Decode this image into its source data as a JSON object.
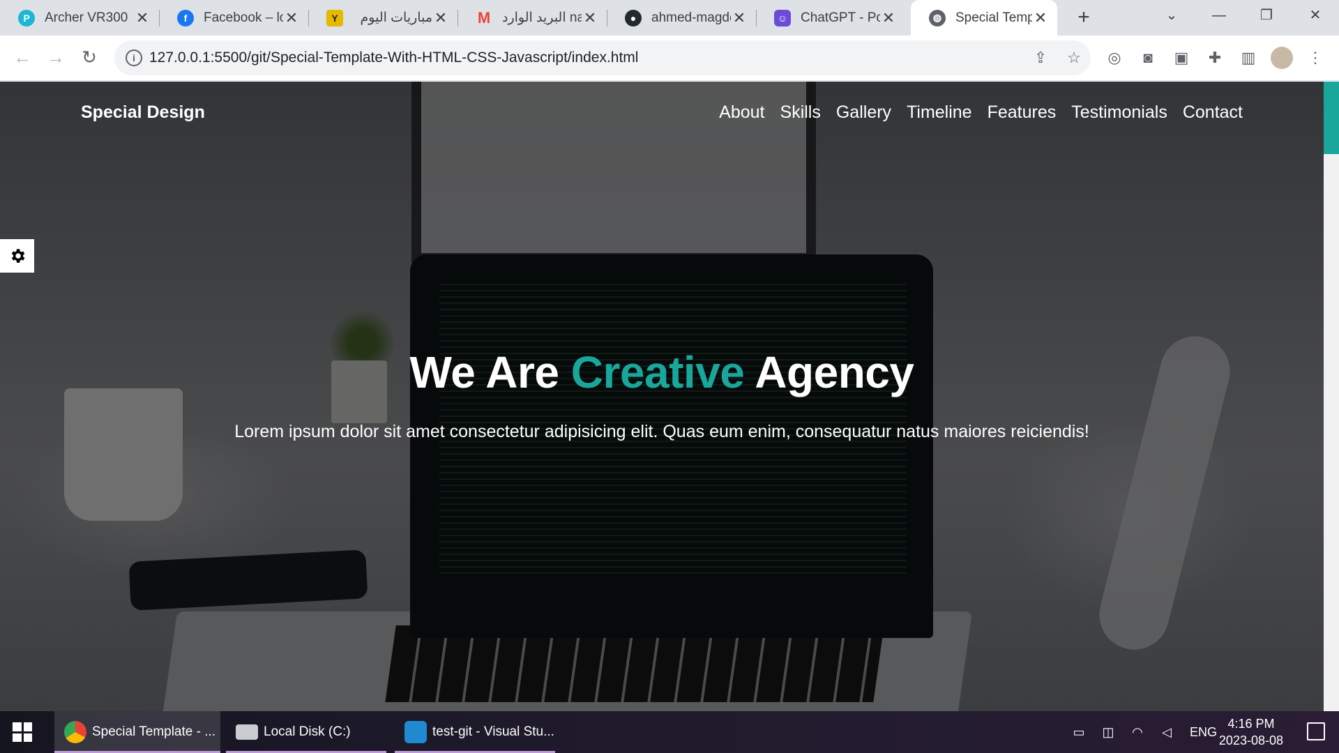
{
  "browser": {
    "tabs": [
      {
        "label": "Archer VR300",
        "icon": "tplink-icon",
        "color": "#1bb7d4"
      },
      {
        "label": "Facebook – log",
        "icon": "facebook-icon",
        "color": "#1877f2"
      },
      {
        "label": "مباريات اليوم",
        "icon": "yallakora-icon",
        "color": "#e5b900"
      },
      {
        "label": "البريد الوارد nail",
        "icon": "gmail-icon",
        "color": "#ea4335"
      },
      {
        "label": "ahmed-magde",
        "icon": "github-icon",
        "color": "#24292f"
      },
      {
        "label": "ChatGPT - Poe",
        "icon": "poe-icon",
        "color": "#6a4cd8"
      },
      {
        "label": "Special Templa",
        "icon": "globe-icon",
        "color": "#5f6368",
        "active": true
      }
    ],
    "url": "127.0.0.1:5500/git/Special-Template-With-HTML-CSS-Javascript/index.html"
  },
  "site": {
    "logo": "Special Design",
    "nav": [
      "About",
      "Skills",
      "Gallery",
      "Timeline",
      "Features",
      "Testimonials",
      "Contact"
    ],
    "hero": {
      "title_pre": "We Are",
      "title_accent": "Creative",
      "title_post": "Agency",
      "subtitle": "Lorem ipsum dolor sit amet consectetur adipisicing elit. Quas eum enim, consequatur natus maiores reiciendis!"
    },
    "accent_color": "#19a79b"
  },
  "taskbar": {
    "tasks": [
      {
        "label": "Special Template - ...",
        "icon": "chrome-icon",
        "active": true
      },
      {
        "label": "Local Disk (C:)",
        "icon": "drive-icon",
        "active": false
      },
      {
        "label": "test-git - Visual Stu...",
        "icon": "vscode-icon",
        "active": false
      }
    ],
    "language": "ENG",
    "time": "4:16 PM",
    "date": "2023-08-08"
  }
}
